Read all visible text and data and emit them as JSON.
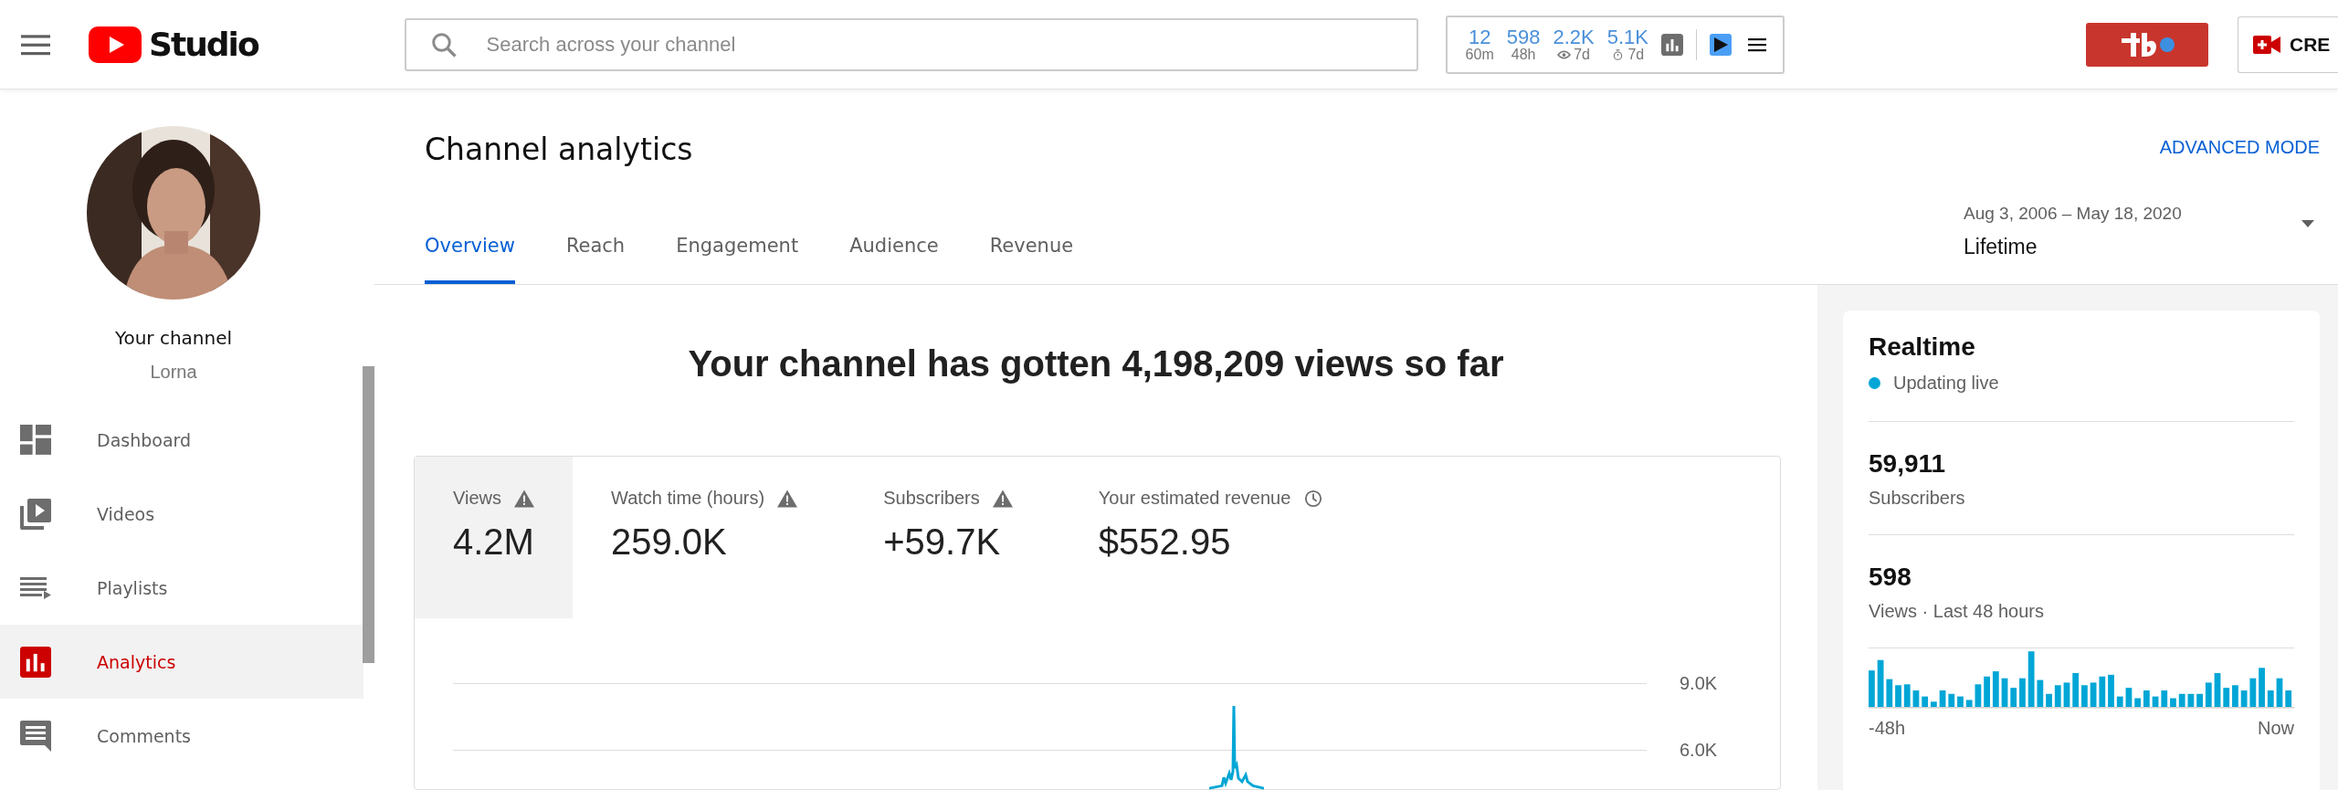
{
  "topbar": {
    "logo_text": "Studio",
    "search": {
      "placeholder": "Search across your channel"
    },
    "stats": [
      {
        "value": "12",
        "caption": "60m",
        "kind": "plain"
      },
      {
        "value": "598",
        "caption": "48h",
        "kind": "plain"
      },
      {
        "value": "2.2K",
        "caption": "7d",
        "kind": "eye"
      },
      {
        "value": "5.1K",
        "caption": "7d",
        "kind": "timer"
      }
    ],
    "create_button": {
      "label": "CRE"
    }
  },
  "sidebar": {
    "channel_title": "Your channel",
    "channel_name": "Lorna",
    "items": [
      {
        "label": "Dashboard",
        "kind": "dashboard",
        "selected": false
      },
      {
        "label": "Videos",
        "kind": "videos",
        "selected": false
      },
      {
        "label": "Playlists",
        "kind": "playlists",
        "selected": false
      },
      {
        "label": "Analytics",
        "kind": "analytics",
        "selected": true
      },
      {
        "label": "Comments",
        "kind": "comments",
        "selected": false
      }
    ]
  },
  "header": {
    "title": "Channel analytics",
    "advanced_mode": "ADVANCED MODE",
    "tabs": [
      {
        "label": "Overview",
        "selected": true
      },
      {
        "label": "Reach",
        "selected": false
      },
      {
        "label": "Engagement",
        "selected": false
      },
      {
        "label": "Audience",
        "selected": false
      },
      {
        "label": "Revenue",
        "selected": false
      }
    ],
    "date_range": {
      "range": "Aug 3, 2006 – May 18, 2020",
      "period": "Lifetime"
    }
  },
  "overview": {
    "headline": "Your channel has gotten 4,198,209 views so far",
    "metrics": [
      {
        "label": "Views",
        "value": "4.2M",
        "kind": "warning",
        "selected": true
      },
      {
        "label": "Watch time (hours)",
        "value": "259.0K",
        "kind": "warning",
        "selected": false
      },
      {
        "label": "Subscribers",
        "value": "+59.7K",
        "kind": "warning",
        "selected": false
      },
      {
        "label": "Your estimated revenue",
        "value": "$552.95",
        "kind": "clock",
        "selected": false
      }
    ],
    "chart_ticks": [
      "9.0K",
      "6.0K"
    ]
  },
  "realtime": {
    "title": "Realtime",
    "status": "Updating live",
    "stats": [
      {
        "value": "59,911",
        "caption": "Subscribers"
      },
      {
        "value": "598",
        "caption": "Views · Last 48 hours"
      }
    ],
    "axis": [
      "-48h",
      "Now"
    ]
  }
}
